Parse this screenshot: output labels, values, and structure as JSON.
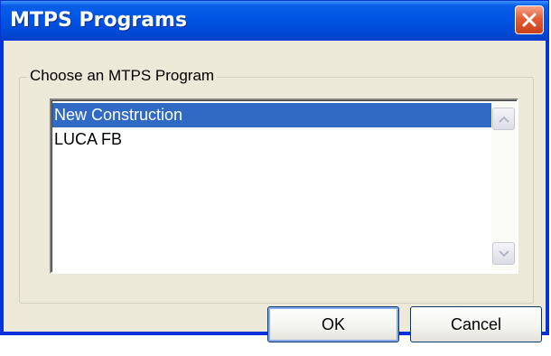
{
  "window": {
    "title": "MTPS Programs"
  },
  "group": {
    "legend": "Choose an MTPS Program"
  },
  "list": {
    "items": [
      {
        "label": "New Construction",
        "selected": true
      },
      {
        "label": "LUCA FB",
        "selected": false
      }
    ]
  },
  "buttons": {
    "ok_label": "OK",
    "cancel_label": "Cancel"
  },
  "colors": {
    "titlebar": "#0055e5",
    "selection": "#316ac5",
    "dialog_bg": "#ece9d8",
    "close_button": "#e35d36"
  },
  "icons": {
    "close": "close-icon",
    "scroll_up": "chevron-up-icon",
    "scroll_down": "chevron-down-icon"
  }
}
